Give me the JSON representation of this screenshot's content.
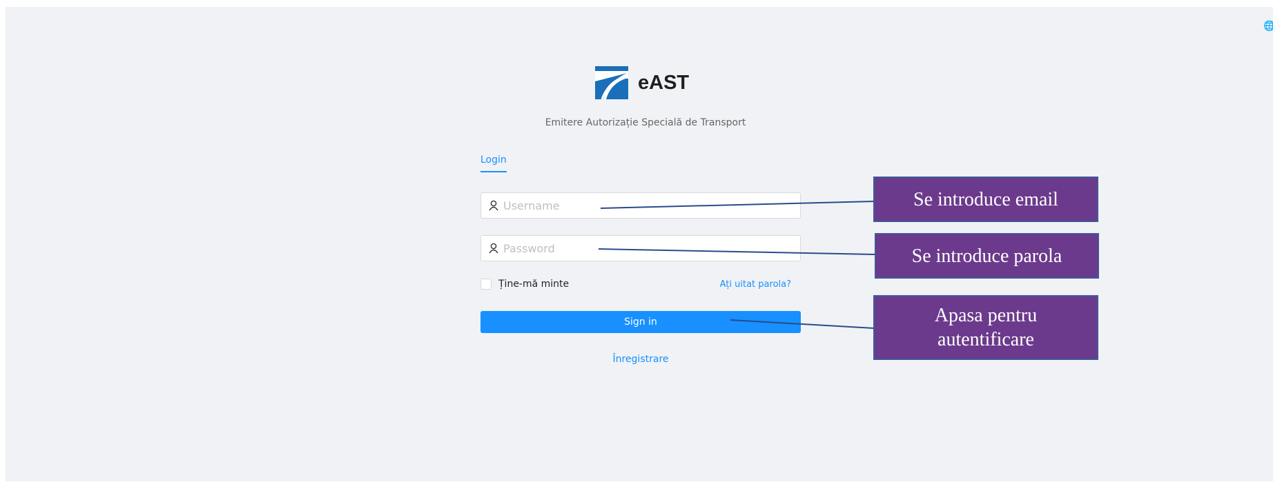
{
  "brand": {
    "title": "eAST",
    "subtitle": "Emitere Autorizație Specială de Transport",
    "logo_icon": "east-logo-icon",
    "logo_color": "#1a6fb8"
  },
  "language_icon": "globe-icon",
  "login": {
    "tab_label": "Login",
    "username_placeholder": "Username",
    "password_placeholder": "Password",
    "remember_label": "Ține-mă minte",
    "forgot_label": "Ați uitat parola?",
    "signin_label": "Sign in",
    "register_label": "Înregistrare"
  },
  "annotations": {
    "email": "Se introduce email",
    "password": "Se introduce parola",
    "signin": "Apasa pentru autentificare"
  },
  "colors": {
    "accent": "#1890ff",
    "background": "#f0f2f5",
    "callout_fill": "#6b3a8c",
    "callout_border": "#3d5a9a"
  }
}
